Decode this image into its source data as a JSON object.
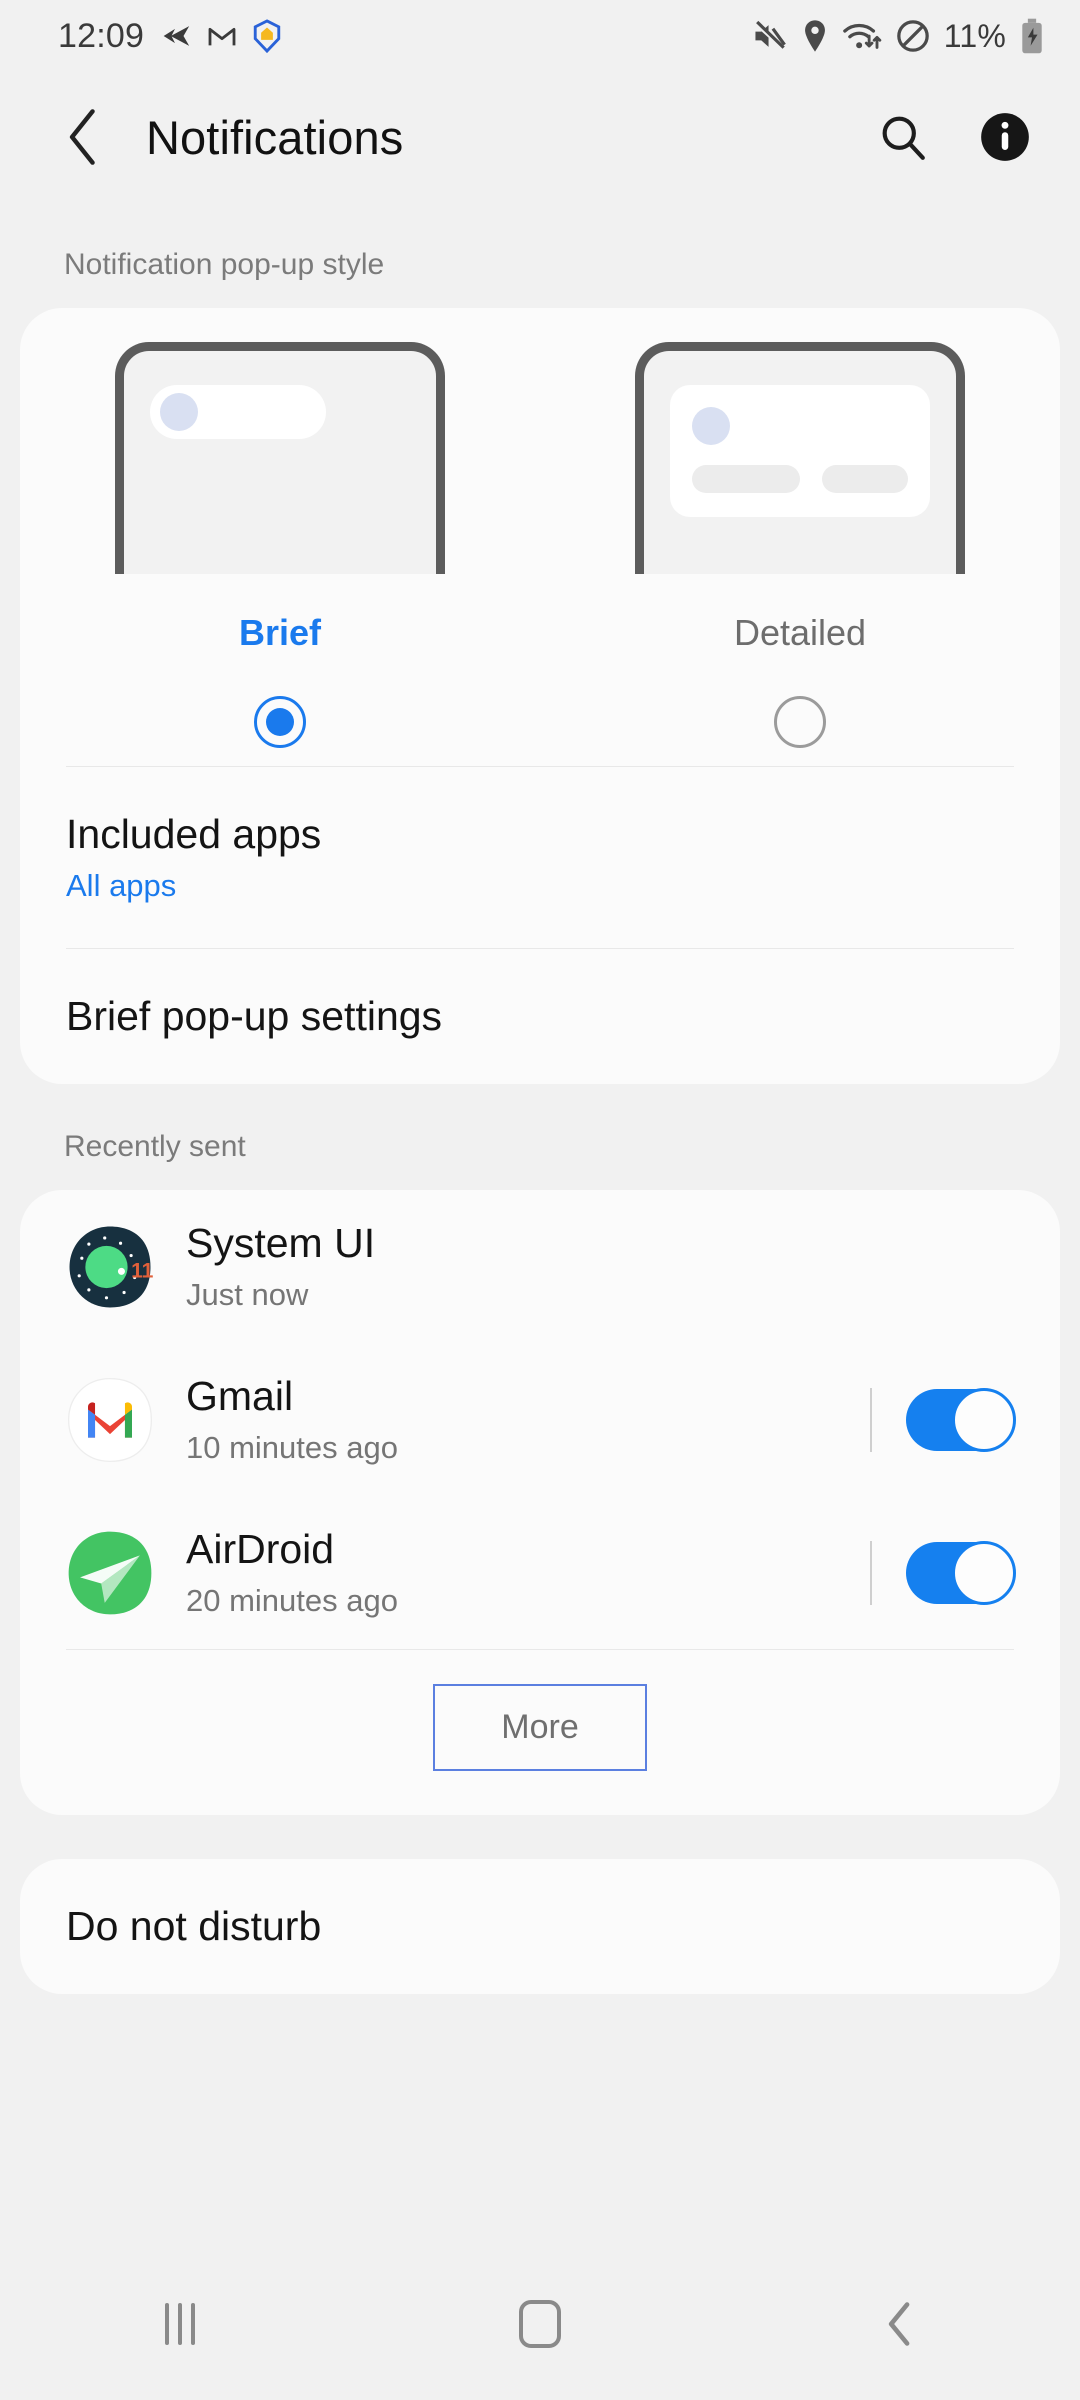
{
  "status_bar": {
    "time": "12:09",
    "battery_percent": "11%",
    "left_icons": [
      "airdroid-arrow-icon",
      "gmail-m-icon",
      "shield-home-icon"
    ],
    "right_icons": [
      "mute-icon",
      "location-pin-icon",
      "wifi-transfer-icon",
      "do-not-disturb-icon",
      "battery-charging-icon"
    ]
  },
  "app_bar": {
    "title": "Notifications",
    "back_icon": "back-chevron-icon",
    "search_icon": "search-icon",
    "info_icon": "info-icon"
  },
  "popup_style": {
    "section_label": "Notification pop-up style",
    "options": [
      {
        "label": "Brief",
        "selected": true
      },
      {
        "label": "Detailed",
        "selected": false
      }
    ],
    "included_apps": {
      "title": "Included apps",
      "value": "All apps"
    },
    "brief_settings": {
      "title": "Brief pop-up settings"
    }
  },
  "recently_sent": {
    "section_label": "Recently sent",
    "apps": [
      {
        "name": "System UI",
        "time": "Just now",
        "icon": "system-ui-icon",
        "has_toggle": false
      },
      {
        "name": "Gmail",
        "time": "10 minutes ago",
        "icon": "gmail-icon",
        "has_toggle": true,
        "toggle_on": true
      },
      {
        "name": "AirDroid",
        "time": "20 minutes ago",
        "icon": "airdroid-icon",
        "has_toggle": true,
        "toggle_on": true
      }
    ],
    "more_label": "More"
  },
  "do_not_disturb": {
    "title": "Do not disturb"
  },
  "nav_bar": {
    "recents_label": "recents-icon",
    "home_label": "home-icon",
    "back_label": "back-icon"
  },
  "colors": {
    "accent_blue": "#1a7aed",
    "toggle_blue": "#1580ef",
    "page_bg": "#f1f1f1",
    "card_bg": "#fbfbfb",
    "muted_text": "#757575"
  }
}
